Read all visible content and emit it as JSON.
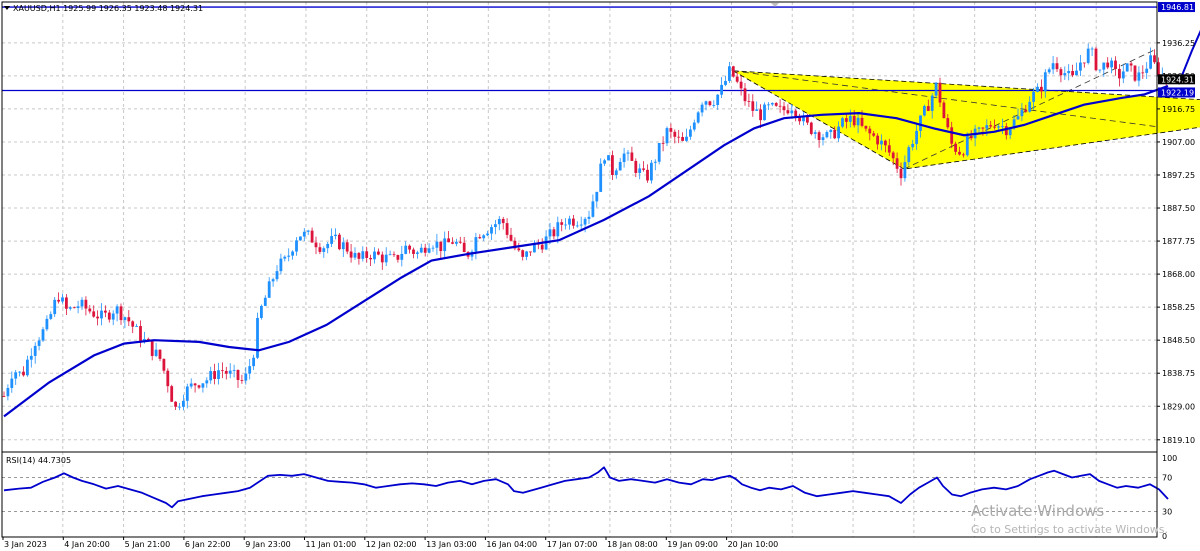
{
  "header": {
    "symbol_info": "XAUUSD,H1  1925.99 1926.35 1923.48 1924.31"
  },
  "watermark": {
    "line1": "Activate Windows",
    "line2": "Go to Settings to activate Windows."
  },
  "colors": {
    "bull": "#1e90ff",
    "bear": "#dc143c",
    "ma": "#0000cd",
    "hline": "#0000cd",
    "triangle": "#ffff00",
    "rsi": "#0000cd",
    "grid": "#c8c8c8"
  },
  "chart_data": [
    {
      "type": "candlestick",
      "name": "price",
      "y_ticks": [
        1946.81,
        1936.25,
        1926.5,
        1924.31,
        1922.19,
        1916.75,
        1907.0,
        1897.25,
        1887.5,
        1877.75,
        1868.0,
        1858.25,
        1848.5,
        1838.75,
        1829.0,
        1819.1
      ],
      "y_tick_labels": [
        "1946.81",
        "1936.25",
        "1926.50",
        "1924.31",
        "1922.19",
        "1916.75",
        "1907.00",
        "1897.25",
        "1887.50",
        "1877.75",
        "1868.00",
        "1858.25",
        "1848.50",
        "1838.75",
        "1829.00",
        "1819.10"
      ],
      "ylim": [
        1815.5,
        1948.3
      ],
      "x_tick_labels": [
        "3 Jan 2023",
        "4 Jan 20:00",
        "5 Jan 21:00",
        "6 Jan 22:00",
        "9 Jan 23:00",
        "11 Jan 01:00",
        "12 Jan 02:00",
        "13 Jan 03:00",
        "16 Jan 04:00",
        "17 Jan 07:00",
        "18 Jan 08:00",
        "19 Jan 09:00",
        "20 Jan 10:00"
      ],
      "current_price": {
        "value": 1924.31,
        "label": "1924.31"
      },
      "horizontal_lines": [
        {
          "value": 1946.81,
          "label": "1946.81"
        },
        {
          "value": 1922.19,
          "label": "1922.19"
        }
      ],
      "price_path": [
        [
          0,
          1832
        ],
        [
          6,
          1840
        ],
        [
          12,
          1838
        ],
        [
          20,
          1848
        ],
        [
          28,
          1852
        ],
        [
          36,
          1862
        ],
        [
          42,
          1857
        ],
        [
          50,
          1859
        ],
        [
          58,
          1857
        ],
        [
          66,
          1855
        ],
        [
          74,
          1858
        ],
        [
          82,
          1855
        ],
        [
          90,
          1850
        ],
        [
          98,
          1846
        ],
        [
          104,
          1843
        ],
        [
          110,
          1835
        ],
        [
          114,
          1828
        ],
        [
          120,
          1833
        ],
        [
          128,
          1836
        ],
        [
          136,
          1837
        ],
        [
          144,
          1840
        ],
        [
          152,
          1838
        ],
        [
          160,
          1836
        ],
        [
          166,
          1844
        ],
        [
          170,
          1856
        ],
        [
          176,
          1863
        ],
        [
          182,
          1870
        ],
        [
          188,
          1872
        ],
        [
          196,
          1880
        ],
        [
          204,
          1879
        ],
        [
          212,
          1876
        ],
        [
          220,
          1878
        ],
        [
          228,
          1876
        ],
        [
          236,
          1872
        ],
        [
          244,
          1874
        ],
        [
          252,
          1873
        ],
        [
          260,
          1872
        ],
        [
          268,
          1876
        ],
        [
          276,
          1874
        ],
        [
          284,
          1878
        ],
        [
          292,
          1876
        ],
        [
          300,
          1878
        ],
        [
          308,
          1873
        ],
        [
          316,
          1880
        ],
        [
          324,
          1882
        ],
        [
          332,
          1884
        ],
        [
          340,
          1876
        ],
        [
          346,
          1872
        ],
        [
          352,
          1876
        ],
        [
          358,
          1877
        ],
        [
          366,
          1880
        ],
        [
          374,
          1884
        ],
        [
          382,
          1884
        ],
        [
          390,
          1886
        ],
        [
          396,
          1895
        ],
        [
          400,
          1904
        ],
        [
          406,
          1898
        ],
        [
          412,
          1904
        ],
        [
          420,
          1900
        ],
        [
          428,
          1896
        ],
        [
          436,
          1904
        ],
        [
          442,
          1910
        ],
        [
          448,
          1908
        ],
        [
          454,
          1906
        ],
        [
          460,
          1914
        ],
        [
          466,
          1920
        ],
        [
          472,
          1919
        ],
        [
          478,
          1922
        ],
        [
          484,
          1928
        ],
        [
          488,
          1925
        ],
        [
          492,
          1921
        ],
        [
          498,
          1917
        ],
        [
          504,
          1915
        ],
        [
          510,
          1917
        ],
        [
          518,
          1916
        ],
        [
          526,
          1918
        ],
        [
          534,
          1912
        ],
        [
          542,
          1910
        ],
        [
          550,
          1908
        ],
        [
          558,
          1912
        ],
        [
          566,
          1914
        ],
        [
          574,
          1910
        ],
        [
          582,
          1908
        ],
        [
          590,
          1904
        ],
        [
          598,
          1898
        ],
        [
          604,
          1906
        ],
        [
          610,
          1912
        ],
        [
          616,
          1918
        ],
        [
          622,
          1924
        ],
        [
          626,
          1915
        ],
        [
          632,
          1906
        ],
        [
          638,
          1904
        ],
        [
          644,
          1908
        ],
        [
          652,
          1910
        ],
        [
          660,
          1913
        ],
        [
          668,
          1911
        ],
        [
          676,
          1914
        ],
        [
          684,
          1920
        ],
        [
          690,
          1922
        ],
        [
          696,
          1928
        ],
        [
          700,
          1931
        ],
        [
          706,
          1928
        ],
        [
          712,
          1925
        ],
        [
          718,
          1931
        ],
        [
          724,
          1934
        ],
        [
          730,
          1928
        ],
        [
          736,
          1931
        ],
        [
          742,
          1926
        ],
        [
          748,
          1929
        ],
        [
          756,
          1926
        ],
        [
          764,
          1931
        ],
        [
          770,
          1928
        ],
        [
          776,
          1924.3
        ]
      ],
      "ma_path": [
        [
          0,
          1826
        ],
        [
          30,
          1836
        ],
        [
          60,
          1844
        ],
        [
          80,
          1847.5
        ],
        [
          100,
          1848.5
        ],
        [
          130,
          1848
        ],
        [
          150,
          1846.5
        ],
        [
          170,
          1845.5
        ],
        [
          190,
          1848
        ],
        [
          215,
          1853
        ],
        [
          240,
          1860
        ],
        [
          265,
          1867
        ],
        [
          285,
          1872
        ],
        [
          310,
          1874
        ],
        [
          340,
          1876
        ],
        [
          370,
          1878
        ],
        [
          400,
          1884
        ],
        [
          430,
          1891
        ],
        [
          460,
          1900
        ],
        [
          480,
          1906
        ],
        [
          500,
          1911
        ],
        [
          520,
          1914
        ],
        [
          545,
          1915
        ],
        [
          570,
          1915.5
        ],
        [
          595,
          1914
        ],
        [
          620,
          1911
        ],
        [
          640,
          1909
        ],
        [
          660,
          1910
        ],
        [
          680,
          1912
        ],
        [
          700,
          1915
        ],
        [
          720,
          1918
        ],
        [
          745,
          1920
        ],
        [
          760,
          1921
        ],
        [
          776,
          1923.5
        ]
      ],
      "triangle": [
        [
          486,
          1928
        ],
        [
          600,
          1899
        ],
        [
          888,
          1917
        ]
      ],
      "projection": [
        [
          783,
          1924
        ],
        [
          792,
          1934
        ],
        [
          800,
          1942
        ],
        [
          812,
          1937
        ],
        [
          824,
          1932
        ],
        [
          834,
          1936
        ],
        [
          842,
          1944
        ],
        [
          846,
          1948
        ]
      ],
      "trend_lines": [
        {
          "from": [
            486,
            1928
          ],
          "to": [
            1155,
            1911.5
          ]
        },
        {
          "from": [
            600,
            1899
          ],
          "to": [
            1155,
            1934.5
          ]
        }
      ]
    },
    {
      "type": "line",
      "name": "rsi",
      "label": "RSI(14) 44.7305",
      "value": 44.7305,
      "ylim": [
        0,
        100
      ],
      "y_ticks": [
        100,
        70,
        30,
        0
      ],
      "y_tick_labels": [
        "100",
        "70",
        "30",
        "0"
      ],
      "points": [
        [
          0,
          55
        ],
        [
          10,
          57
        ],
        [
          18,
          58
        ],
        [
          26,
          65
        ],
        [
          34,
          70
        ],
        [
          40,
          75
        ],
        [
          46,
          70
        ],
        [
          52,
          66
        ],
        [
          60,
          62
        ],
        [
          68,
          57
        ],
        [
          76,
          60
        ],
        [
          84,
          56
        ],
        [
          92,
          52
        ],
        [
          100,
          46
        ],
        [
          108,
          40
        ],
        [
          112,
          35
        ],
        [
          116,
          42
        ],
        [
          124,
          45
        ],
        [
          132,
          48
        ],
        [
          140,
          50
        ],
        [
          148,
          52
        ],
        [
          156,
          54
        ],
        [
          164,
          58
        ],
        [
          170,
          65
        ],
        [
          176,
          72
        ],
        [
          184,
          73
        ],
        [
          192,
          72
        ],
        [
          200,
          74
        ],
        [
          208,
          70
        ],
        [
          216,
          66
        ],
        [
          224,
          65
        ],
        [
          232,
          64
        ],
        [
          240,
          62
        ],
        [
          248,
          58
        ],
        [
          256,
          60
        ],
        [
          264,
          62
        ],
        [
          272,
          63
        ],
        [
          280,
          62
        ],
        [
          288,
          60
        ],
        [
          296,
          64
        ],
        [
          304,
          66
        ],
        [
          312,
          62
        ],
        [
          320,
          66
        ],
        [
          328,
          68
        ],
        [
          336,
          62
        ],
        [
          340,
          54
        ],
        [
          346,
          52
        ],
        [
          352,
          55
        ],
        [
          358,
          58
        ],
        [
          366,
          62
        ],
        [
          374,
          66
        ],
        [
          382,
          68
        ],
        [
          390,
          70
        ],
        [
          396,
          76
        ],
        [
          400,
          82
        ],
        [
          404,
          70
        ],
        [
          410,
          66
        ],
        [
          418,
          68
        ],
        [
          426,
          66
        ],
        [
          434,
          64
        ],
        [
          442,
          68
        ],
        [
          450,
          64
        ],
        [
          458,
          62
        ],
        [
          466,
          68
        ],
        [
          472,
          67
        ],
        [
          478,
          70
        ],
        [
          484,
          72
        ],
        [
          488,
          68
        ],
        [
          492,
          62
        ],
        [
          498,
          58
        ],
        [
          504,
          55
        ],
        [
          510,
          58
        ],
        [
          518,
          56
        ],
        [
          526,
          60
        ],
        [
          534,
          52
        ],
        [
          542,
          48
        ],
        [
          550,
          50
        ],
        [
          558,
          52
        ],
        [
          566,
          54
        ],
        [
          574,
          52
        ],
        [
          582,
          50
        ],
        [
          590,
          48
        ],
        [
          598,
          40
        ],
        [
          604,
          50
        ],
        [
          610,
          58
        ],
        [
          616,
          64
        ],
        [
          622,
          70
        ],
        [
          626,
          60
        ],
        [
          632,
          50
        ],
        [
          638,
          48
        ],
        [
          644,
          52
        ],
        [
          652,
          56
        ],
        [
          660,
          58
        ],
        [
          668,
          56
        ],
        [
          676,
          60
        ],
        [
          684,
          68
        ],
        [
          690,
          72
        ],
        [
          696,
          76
        ],
        [
          700,
          78
        ],
        [
          706,
          74
        ],
        [
          712,
          70
        ],
        [
          718,
          72
        ],
        [
          724,
          74
        ],
        [
          730,
          66
        ],
        [
          736,
          62
        ],
        [
          742,
          58
        ],
        [
          748,
          60
        ],
        [
          756,
          58
        ],
        [
          764,
          62
        ],
        [
          770,
          56
        ],
        [
          776,
          44.7
        ]
      ]
    }
  ]
}
